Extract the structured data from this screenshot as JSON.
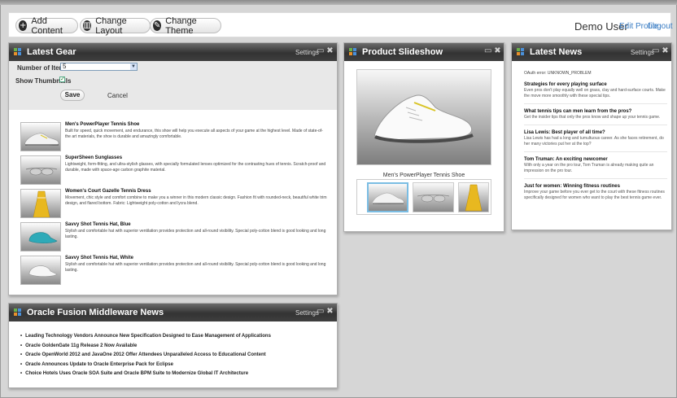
{
  "toolbar": {
    "add_content": "Add Content",
    "change_layout": "Change Layout",
    "change_theme": "Change Theme",
    "user_name": "Demo User",
    "edit_profile": "Edit Profile",
    "logout": "Logout"
  },
  "latest_gear": {
    "title": "Latest Gear",
    "settings": "Settings",
    "number_of_items_label": "Number of Items",
    "number_of_items_value": "5",
    "show_thumbnails_label": "Show Thumbnails",
    "show_thumbnails_checked": true,
    "save_label": "Save",
    "cancel_label": "Cancel",
    "items": [
      {
        "name": "Men's PowerPlayer Tennis Shoe",
        "desc": "Built for speed, quick movement, and endurance, this shoe will help you execute all aspects of your game at the highest level. Made of state-of-the art materials, the shoe is durable and amazingly comfortable.",
        "thumb": "shoe-thumbnail"
      },
      {
        "name": "SuperSheen Sunglasses",
        "desc": "Lightweight, form-fitting, and ultra-stylish glasses, with specially formulated lenses optimized for the contrasting hues of tennis. Scratch-proof and durable, made with space-age carbon graphite material.",
        "thumb": "sunglasses-thumbnail"
      },
      {
        "name": "Women's Court Gazelle Tennis Dress",
        "desc": "Movement, chic style and comfort combine to make you a winner in this modern classic design. Fashion fit with rounded-neck, beautiful white trim design, and flared bottom. Fabric: Lightweight poly-cotton and lycra blend.",
        "thumb": "dress-thumbnail"
      },
      {
        "name": "Savvy Shot Tennis Hat, Blue",
        "desc": "Stylish and comfortable hat with superior ventilation provides protection and all-round visibility. Special poly-cotton blend is good looking and long lasting.",
        "thumb": "blue-hat-thumbnail"
      },
      {
        "name": "Savvy Shot Tennis Hat, White",
        "desc": "Stylish and comfortable hat with superior ventilation provides protection and all-round visibility. Special poly-cotton blend is good looking and long lasting.",
        "thumb": "white-hat-thumbnail"
      }
    ]
  },
  "slideshow": {
    "title": "Product Slideshow",
    "caption": "Men's PowerPlayer Tennis Shoe"
  },
  "news": {
    "title": "Latest News",
    "settings": "Settings",
    "error": "OAuth error: UNKNOWN_PROBLEM",
    "items": [
      {
        "title": "Strategies for every playing surface",
        "desc": "Even pros don't play equally well on grass, clay and hard-surface courts. Make the move more smoothly with these special tips."
      },
      {
        "title": "What tennis tips can men learn from the pros?",
        "desc": "Get the insider tips that only the pros know and shape up your tennis game."
      },
      {
        "title": "Lisa Lewis: Best player of all time?",
        "desc": "Lisa Lewis has had a long and tumultuous career. As she faces retirement, do her many victories put her at the top?"
      },
      {
        "title": "Tom Truman: An exciting newcomer",
        "desc": "With only a year on the pro tour, Tom Truman is already making quite an impression on the pro tour."
      },
      {
        "title": "Just for women: Winning fitness routines",
        "desc": "Improve your game before you ever get to the court with these fitness routines specifically designed for women who want to play the best tennis game ever."
      }
    ]
  },
  "oracle_news": {
    "title": "Oracle Fusion Middleware News",
    "settings": "Settings",
    "items": [
      "Leading Technology Vendors Announce New Specification Designed to Ease Management of Applications",
      "Oracle GoldenGate 11g Release 2 Now Available",
      "Oracle OpenWorld 2012 and JavaOne 2012 Offer Attendees Unparalleled Access to Educational Content",
      "Oracle Announces Update to Oracle Enterprise Pack for Eclipse",
      "Choice Hotels Uses Oracle SOA Suite and Oracle BPM Suite to Modernize Global IT Architecture"
    ]
  },
  "colors": {
    "header_dark": "#333333",
    "link_blue": "#3a7dc4",
    "icon_green": "#6ab04c",
    "icon_blue": "#4a90d9",
    "icon_orange": "#e8902a"
  }
}
